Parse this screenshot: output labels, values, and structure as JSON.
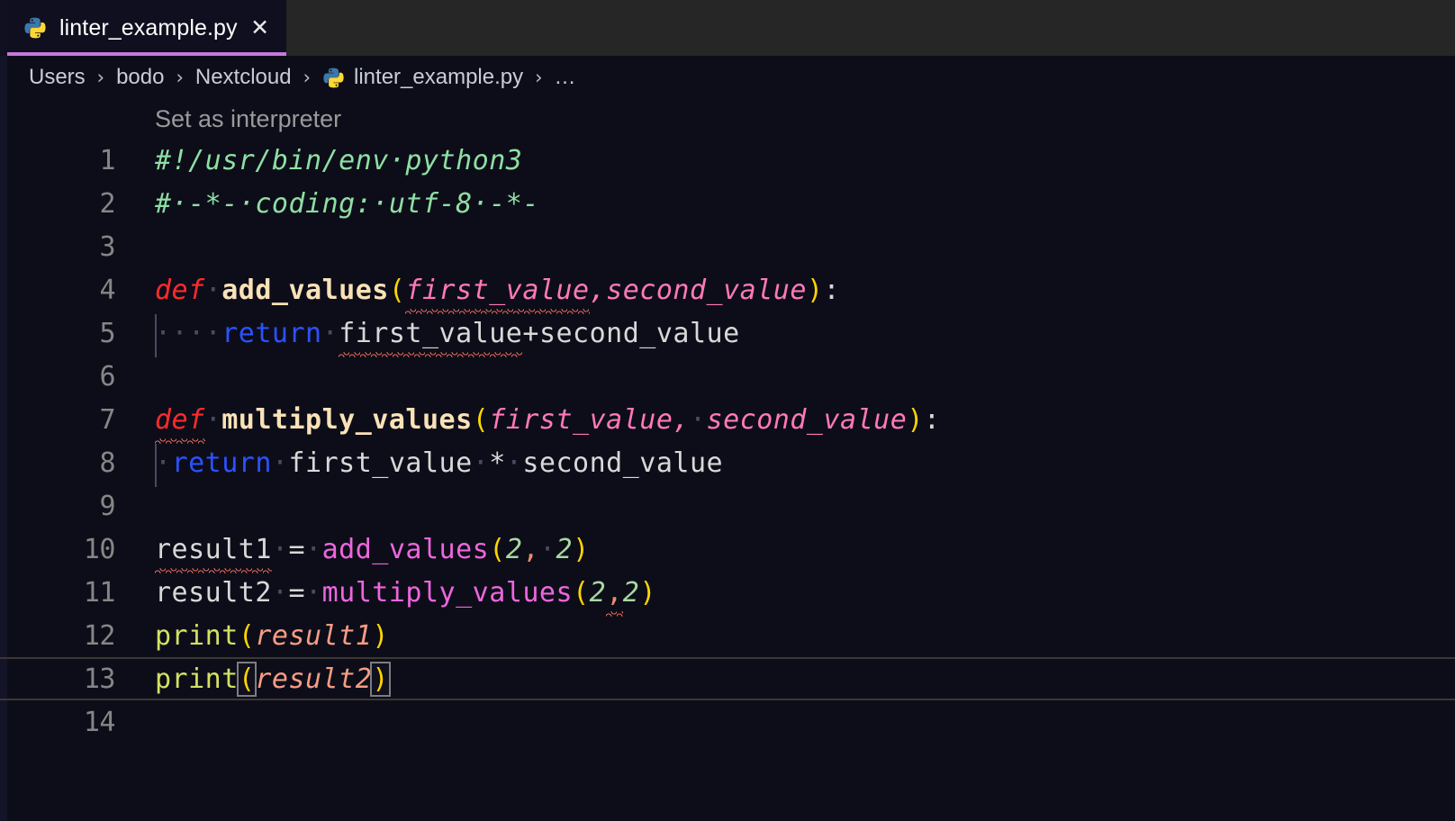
{
  "window": {
    "accent_tab_border": "#c678dd",
    "editor_bg": "#0d0d1a",
    "tabbar_bg": "#262626"
  },
  "tab": {
    "label": "linter_example.py",
    "close_label": "✕",
    "icon": "python-file-icon"
  },
  "breadcrumb": {
    "items": [
      {
        "label": "Users",
        "icon": null
      },
      {
        "label": "bodo",
        "icon": null
      },
      {
        "label": "Nextcloud",
        "icon": null
      },
      {
        "label": "linter_example.py",
        "icon": "python-file-icon"
      },
      {
        "label": "…",
        "icon": null
      }
    ],
    "separator": "›"
  },
  "codelens": {
    "label": "Set as interpreter"
  },
  "editor": {
    "language": "python",
    "active_line": 13,
    "line_numbers": [
      "1",
      "2",
      "3",
      "4",
      "5",
      "6",
      "7",
      "8",
      "9",
      "10",
      "11",
      "12",
      "13",
      "14"
    ],
    "lines": [
      {
        "n": "1",
        "text": "#!/usr/bin/env python3"
      },
      {
        "n": "2",
        "text": "# -*- coding: utf-8 -*-"
      },
      {
        "n": "3",
        "text": ""
      },
      {
        "n": "4",
        "text": "def add_values(first_value,second_value):"
      },
      {
        "n": "5",
        "text": "    return first_value+second_value"
      },
      {
        "n": "6",
        "text": ""
      },
      {
        "n": "7",
        "text": "def multiply_values(first_value, second_value):"
      },
      {
        "n": "8",
        "text": " return first_value * second_value"
      },
      {
        "n": "9",
        "text": ""
      },
      {
        "n": "10",
        "text": "result1 = add_values(2, 2)"
      },
      {
        "n": "11",
        "text": "result2 = multiply_values(2,2)"
      },
      {
        "n": "12",
        "text": "print(result1)"
      },
      {
        "n": "13",
        "text": "print(result2)"
      },
      {
        "n": "14",
        "text": ""
      }
    ],
    "tokens": {
      "l1_comment": "#!/usr/bin/env·python3",
      "l2_comment": "#·-*-·coding:·utf-8·-*-",
      "l4_kw": "def",
      "l4_dot": "·",
      "l4_name": "add_values",
      "l4_open": "(",
      "l4_p1": "first_value",
      "l4_comma": ",",
      "l4_p2": "second_value",
      "l4_close": ")",
      "l4_colon": ":",
      "l5_indent": "····",
      "l5_kw": "return",
      "l5_dot": "·",
      "l5_expr_a": "first_value",
      "l5_op": "+",
      "l5_expr_b": "second_value",
      "l7_kw": "def",
      "l7_dot": "·",
      "l7_name": "multiply_values",
      "l7_open": "(",
      "l7_p1": "first_value",
      "l7_comma": ",",
      "l7_space": "·",
      "l7_p2": "second_value",
      "l7_close": ")",
      "l7_colon": ":",
      "l8_indent": "·",
      "l8_kw": "return",
      "l8_dot": "·",
      "l8_a": "first_value",
      "l8_sp1": "·",
      "l8_op": "*",
      "l8_sp2": "·",
      "l8_b": "second_value",
      "l10_var": "result1",
      "l10_sp1": "·",
      "l10_eq": "=",
      "l10_sp2": "·",
      "l10_call": "add_values",
      "l10_open": "(",
      "l10_n1": "2",
      "l10_comma": ",",
      "l10_sp3": "·",
      "l10_n2": "2",
      "l10_close": ")",
      "l11_var": "result2",
      "l11_sp1": "·",
      "l11_eq": "=",
      "l11_sp2": "·",
      "l11_call": "multiply_values",
      "l11_open": "(",
      "l11_n1": "2",
      "l11_comma": ",",
      "l11_n2": "2",
      "l11_close": ")",
      "l12_fn": "print",
      "l12_open": "(",
      "l12_arg": "result1",
      "l12_close": ")",
      "l13_fn": "print",
      "l13_open": "(",
      "l13_arg": "result2",
      "l13_close": ")"
    }
  }
}
